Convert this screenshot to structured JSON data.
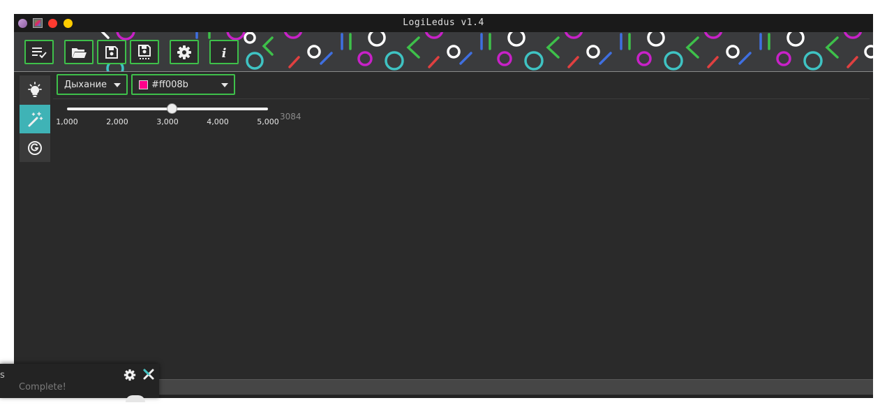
{
  "window": {
    "title": "LogiLedus v1.4"
  },
  "toolbar": {
    "buttons": [
      {
        "name": "playlist-check-icon"
      },
      {
        "name": "folder-open-icon"
      },
      {
        "name": "save-icon"
      },
      {
        "name": "save-as-icon"
      },
      {
        "name": "settings-icon"
      },
      {
        "name": "info-icon"
      }
    ]
  },
  "sidebar": {
    "items": [
      {
        "name": "lightbulb-icon",
        "active": false
      },
      {
        "name": "magic-wand-icon",
        "active": true
      },
      {
        "name": "g-circle-icon",
        "active": false
      }
    ]
  },
  "effect": {
    "selected": "Дыхание"
  },
  "color": {
    "hex": "#ff008b",
    "swatch": "#ff008b"
  },
  "speed": {
    "min": 1000,
    "max": 5000,
    "value": 3084,
    "value_label": "3084",
    "ticks": [
      "1,000",
      "2,000",
      "3,000",
      "4,000",
      "5,000"
    ]
  },
  "notification": {
    "title": "s",
    "status": "Complete!"
  },
  "colors": {
    "accent_green": "#3ec04a",
    "active_teal": "#3fb3b6",
    "background": "#2a2a2a"
  }
}
